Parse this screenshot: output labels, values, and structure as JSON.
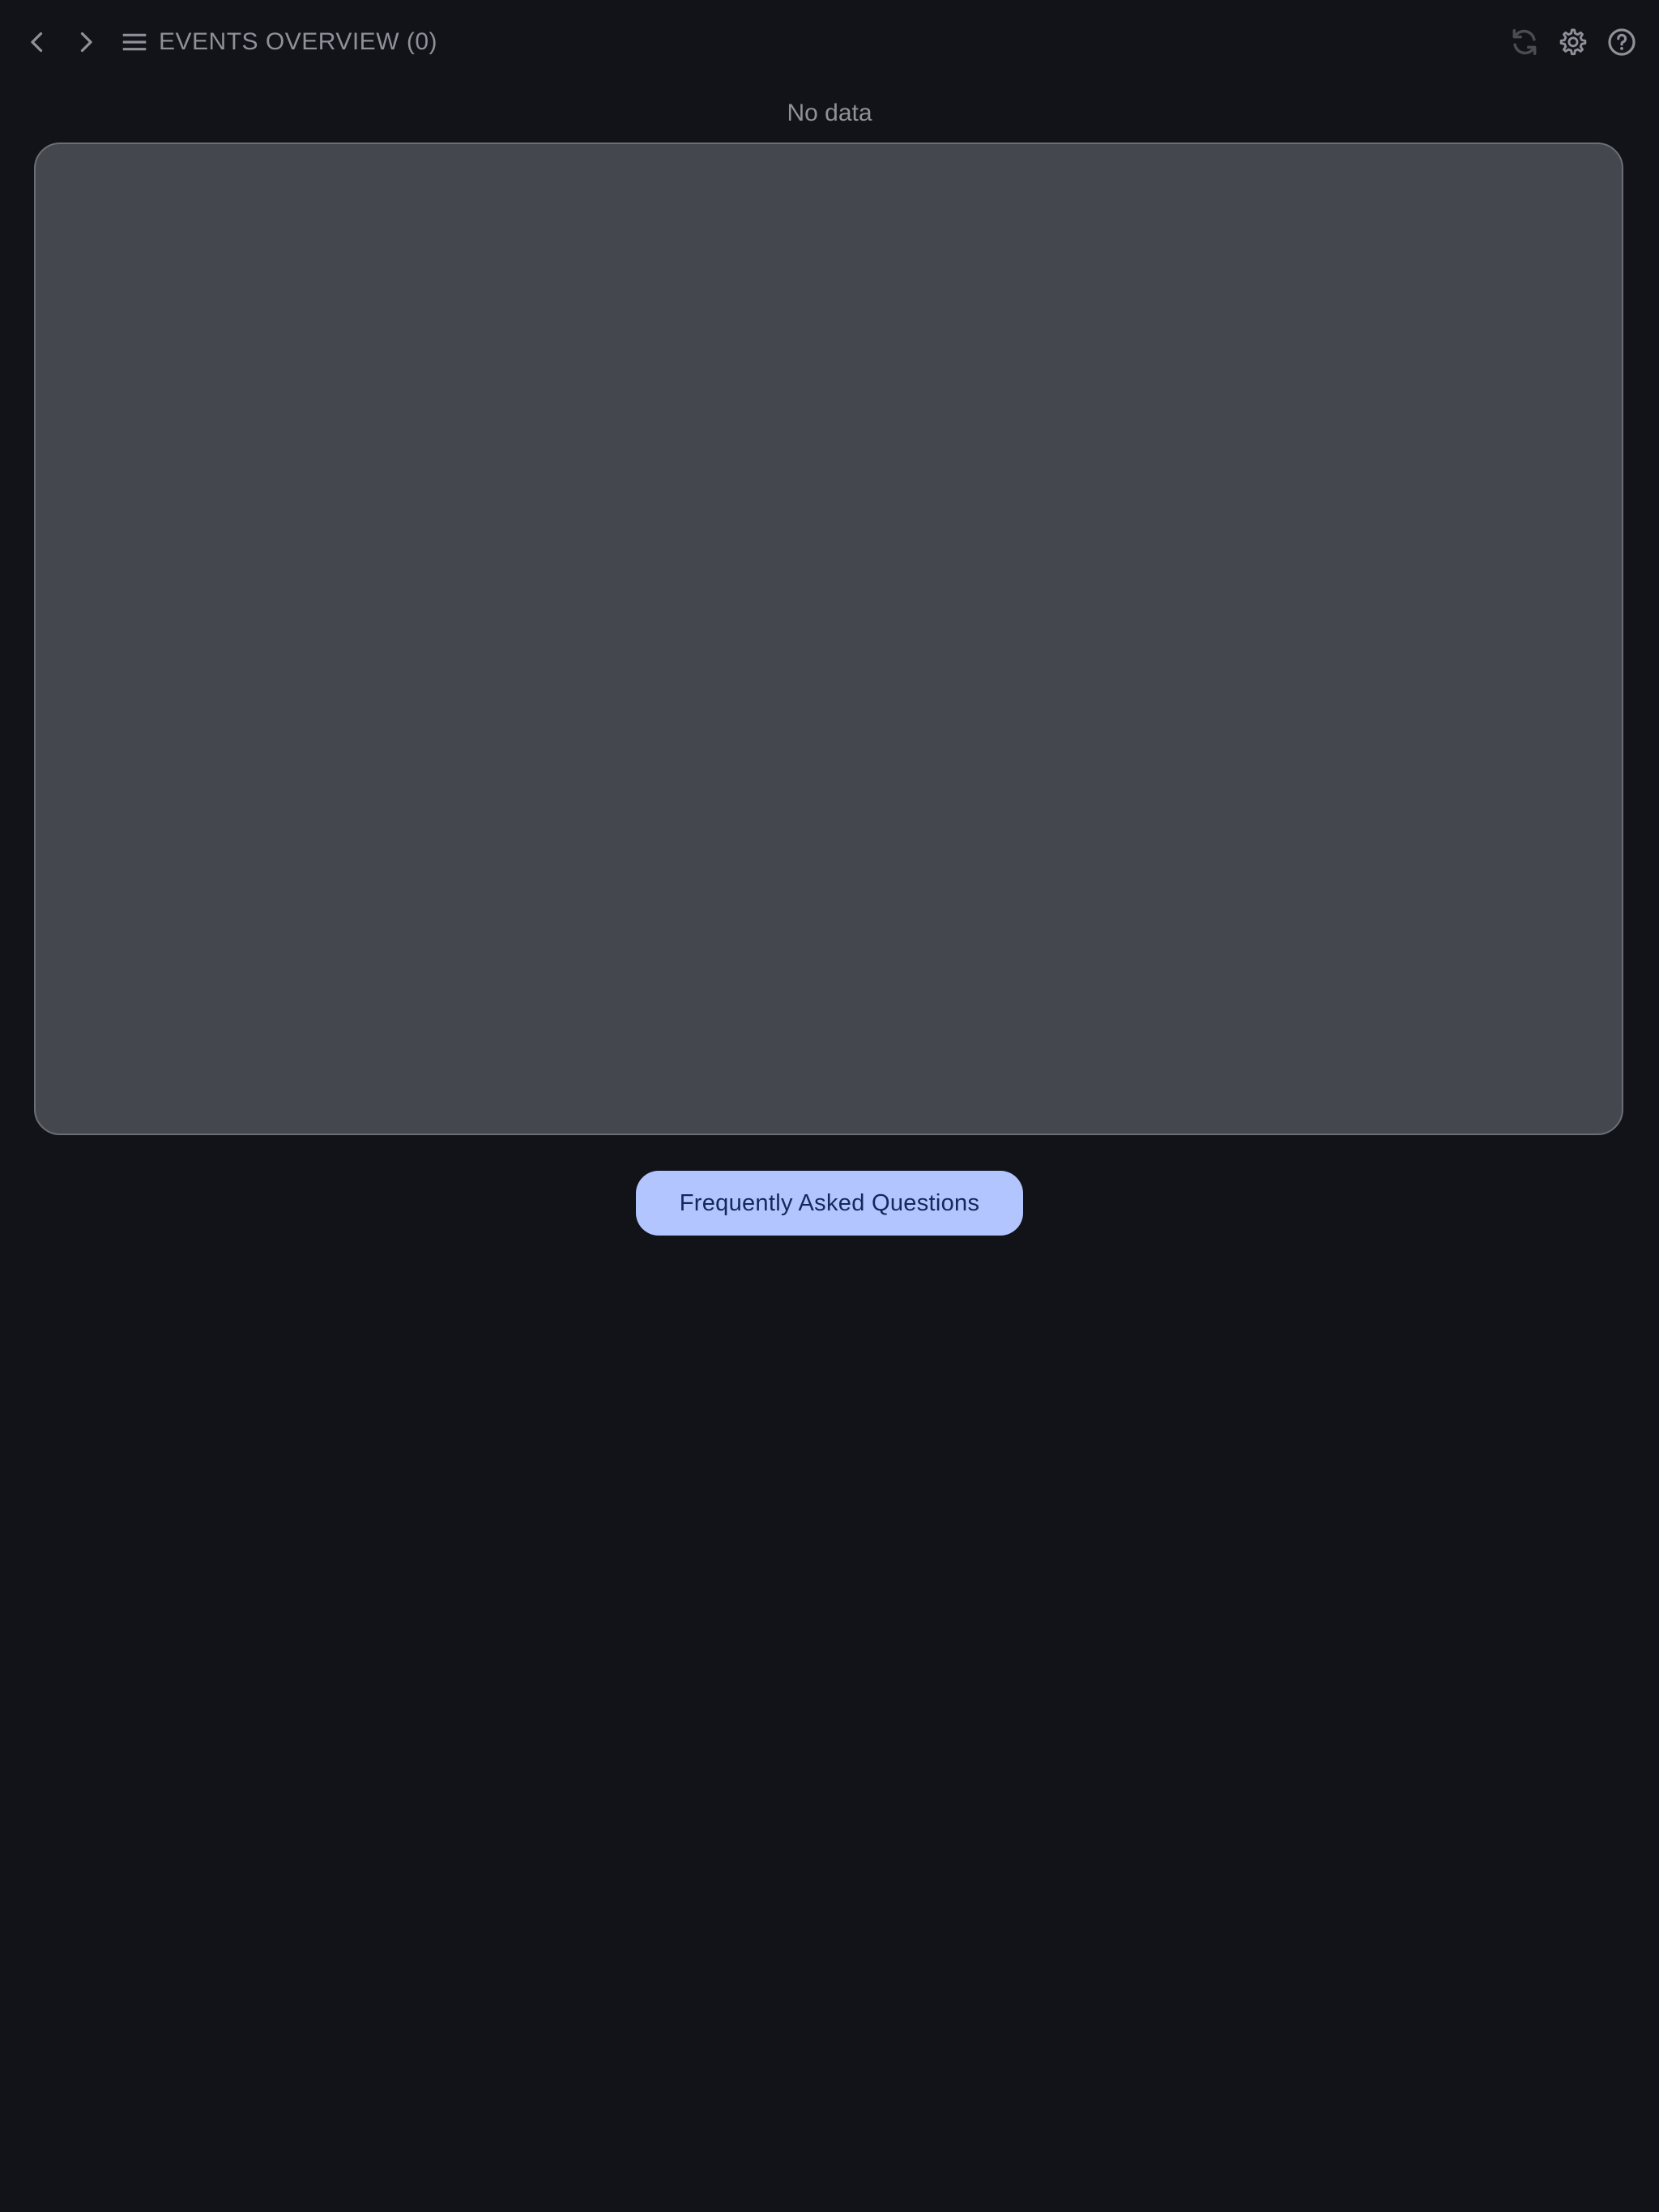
{
  "header": {
    "title": "EVENTS OVERVIEW (0)",
    "icons": {
      "back": "chevron-left-icon",
      "forward": "chevron-right-icon",
      "menu": "menu-icon",
      "refresh": "refresh-icon",
      "settings": "gear-icon",
      "help": "help-icon"
    }
  },
  "main": {
    "empty_message": "No data",
    "faq_button_label": "Frequently Asked Questions"
  },
  "colors": {
    "background": "#121318",
    "panel": "#45474f",
    "button": "#b2c5ff",
    "button_text": "#13295a",
    "muted_text": "#8f9099"
  }
}
